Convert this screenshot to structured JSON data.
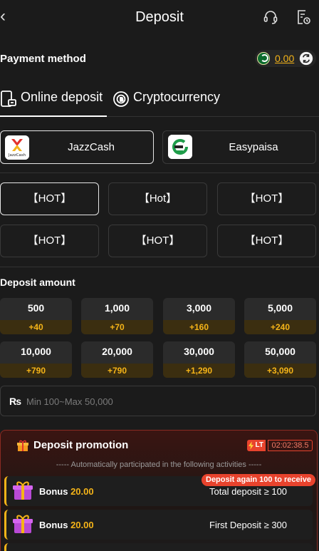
{
  "header": {
    "title": "Deposit",
    "back_icon": "chevron-left-icon",
    "support_icon": "headset-icon",
    "history_icon": "history-doc-icon"
  },
  "payment": {
    "label": "Payment method",
    "balance": "0.00",
    "flag_icon": "pakistan-flag-icon",
    "refresh_icon": "refresh-icon"
  },
  "tabs": [
    {
      "label": "Online deposit",
      "icon": "mobile-deposit-icon",
      "active": true
    },
    {
      "label": "Cryptocurrency",
      "icon": "crypto-coin-icon",
      "active": false
    }
  ],
  "methods": [
    {
      "name": "JazzCash",
      "logo": "jazzcash-logo",
      "selected": true
    },
    {
      "name": "Easypaisa",
      "logo": "easypaisa-logo",
      "selected": false
    }
  ],
  "channels": [
    "【HOT】",
    "【Hot】",
    "【HOT】",
    "【HOT】",
    "【HOT】",
    "【HOT】"
  ],
  "deposit_amount": {
    "label": "Deposit amount",
    "options": [
      {
        "amount": "500",
        "bonus": "+40"
      },
      {
        "amount": "1,000",
        "bonus": "+70"
      },
      {
        "amount": "3,000",
        "bonus": "+160"
      },
      {
        "amount": "5,000",
        "bonus": "+240"
      },
      {
        "amount": "10,000",
        "bonus": "+790"
      },
      {
        "amount": "20,000",
        "bonus": "+790"
      },
      {
        "amount": "30,000",
        "bonus": "+1,290"
      },
      {
        "amount": "50,000",
        "bonus": "+3,090"
      }
    ],
    "currency_symbol": "₨",
    "placeholder": "Min 100~Max 50,000"
  },
  "promotion": {
    "title": "Deposit promotion",
    "badge": "LT",
    "timer": "02:02:38.5",
    "subtitle": "----- Automatically participated in the following activities -----",
    "again_label": "Deposit again 100 to receive",
    "activities": [
      {
        "label": "Bonus",
        "value": "20.00",
        "requirement": "Total deposit ≥ 100"
      },
      {
        "label": "Bonus",
        "value": "20.00",
        "requirement": "First Deposit ≥ 300"
      }
    ]
  },
  "colors": {
    "accent": "#f5b418",
    "danger": "#e8432d",
    "background": "#1b1b1b"
  }
}
